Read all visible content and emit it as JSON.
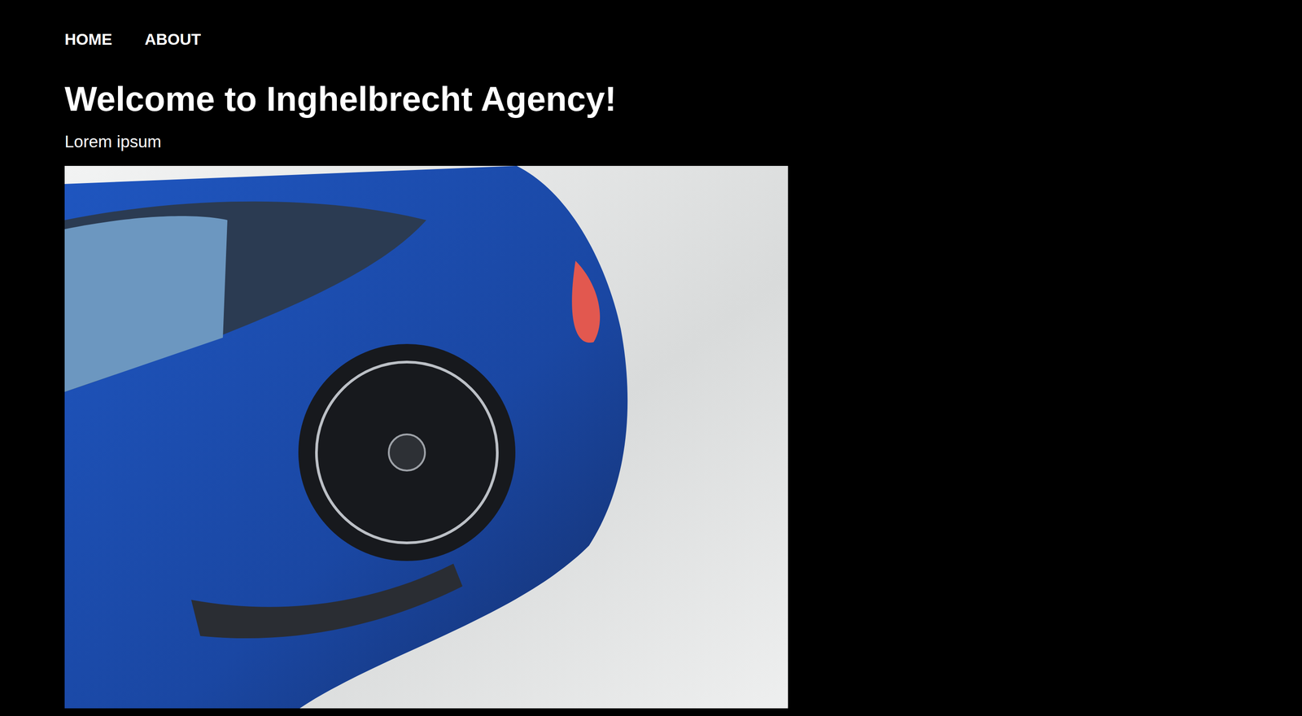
{
  "nav": [
    {
      "label": "HOME"
    },
    {
      "label": "ABOUT"
    }
  ],
  "hero": {
    "title": "Welcome to Inghelbrecht Agency!",
    "subtitle": "Lorem ipsum"
  }
}
